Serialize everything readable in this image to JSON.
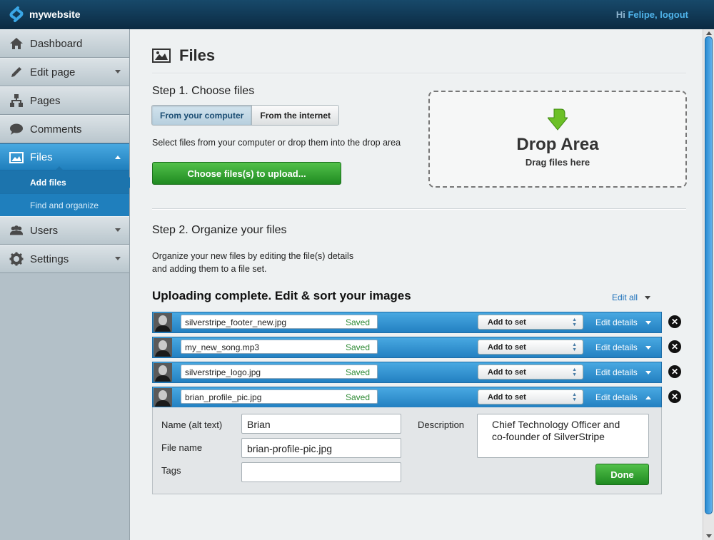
{
  "header": {
    "logo_text": "mywebsite",
    "greeting": "Hi",
    "user_name": "Felipe,",
    "logout": "logout"
  },
  "sidebar": {
    "items": [
      {
        "label": "Dashboard",
        "icon": "home-icon"
      },
      {
        "label": "Edit page",
        "icon": "pencil-icon"
      },
      {
        "label": "Pages",
        "icon": "sitemap-icon"
      },
      {
        "label": "Comments",
        "icon": "speech-bubble-icon"
      },
      {
        "label": "Files",
        "icon": "picture-icon"
      },
      {
        "label": "Users",
        "icon": "users-icon"
      },
      {
        "label": "Settings",
        "icon": "gear-icon"
      }
    ],
    "files_sub": [
      "Add files",
      "Find and organize"
    ]
  },
  "main": {
    "title": "Files",
    "step1": "Step 1. Choose files",
    "tabs": [
      "From your computer",
      "From the internet"
    ],
    "select_hint": "Select files from your computer or drop them into the drop area",
    "choose_button": "Choose files(s) to upload...",
    "drop_title": "Drop Area",
    "drop_sub": "Drag files here",
    "step2": "Step 2. Organize your files",
    "organize_line1": "Organize your new files by editing the file(s) details",
    "organize_line2": "and adding them to a file set.",
    "upload_title": "Uploading complete. Edit & sort your images",
    "edit_all": "Edit all",
    "files": [
      {
        "name": "silverstripe_footer_new.jpg",
        "status": "Saved",
        "set": "Add to set",
        "edit": "Edit details"
      },
      {
        "name": "my_new_song.mp3",
        "status": "Saved",
        "set": "Add to set",
        "edit": "Edit details"
      },
      {
        "name": "silverstripe_logo.jpg",
        "status": "Saved",
        "set": "Add to set",
        "edit": "Edit details"
      },
      {
        "name": "brian_profile_pic.jpg",
        "status": "Saved",
        "set": "Add to set",
        "edit": "Edit details"
      }
    ],
    "details": {
      "name_label": "Name (alt text)",
      "name_value": "Brian",
      "file_label": "File name",
      "file_value": "brian-profile-pic.jpg",
      "tags_label": "Tags",
      "tags_value": "",
      "desc_label": "Description",
      "desc_line1": "Chief Technology Officer and",
      "desc_line2": "co-founder of SilverStripe",
      "done": "Done"
    }
  }
}
